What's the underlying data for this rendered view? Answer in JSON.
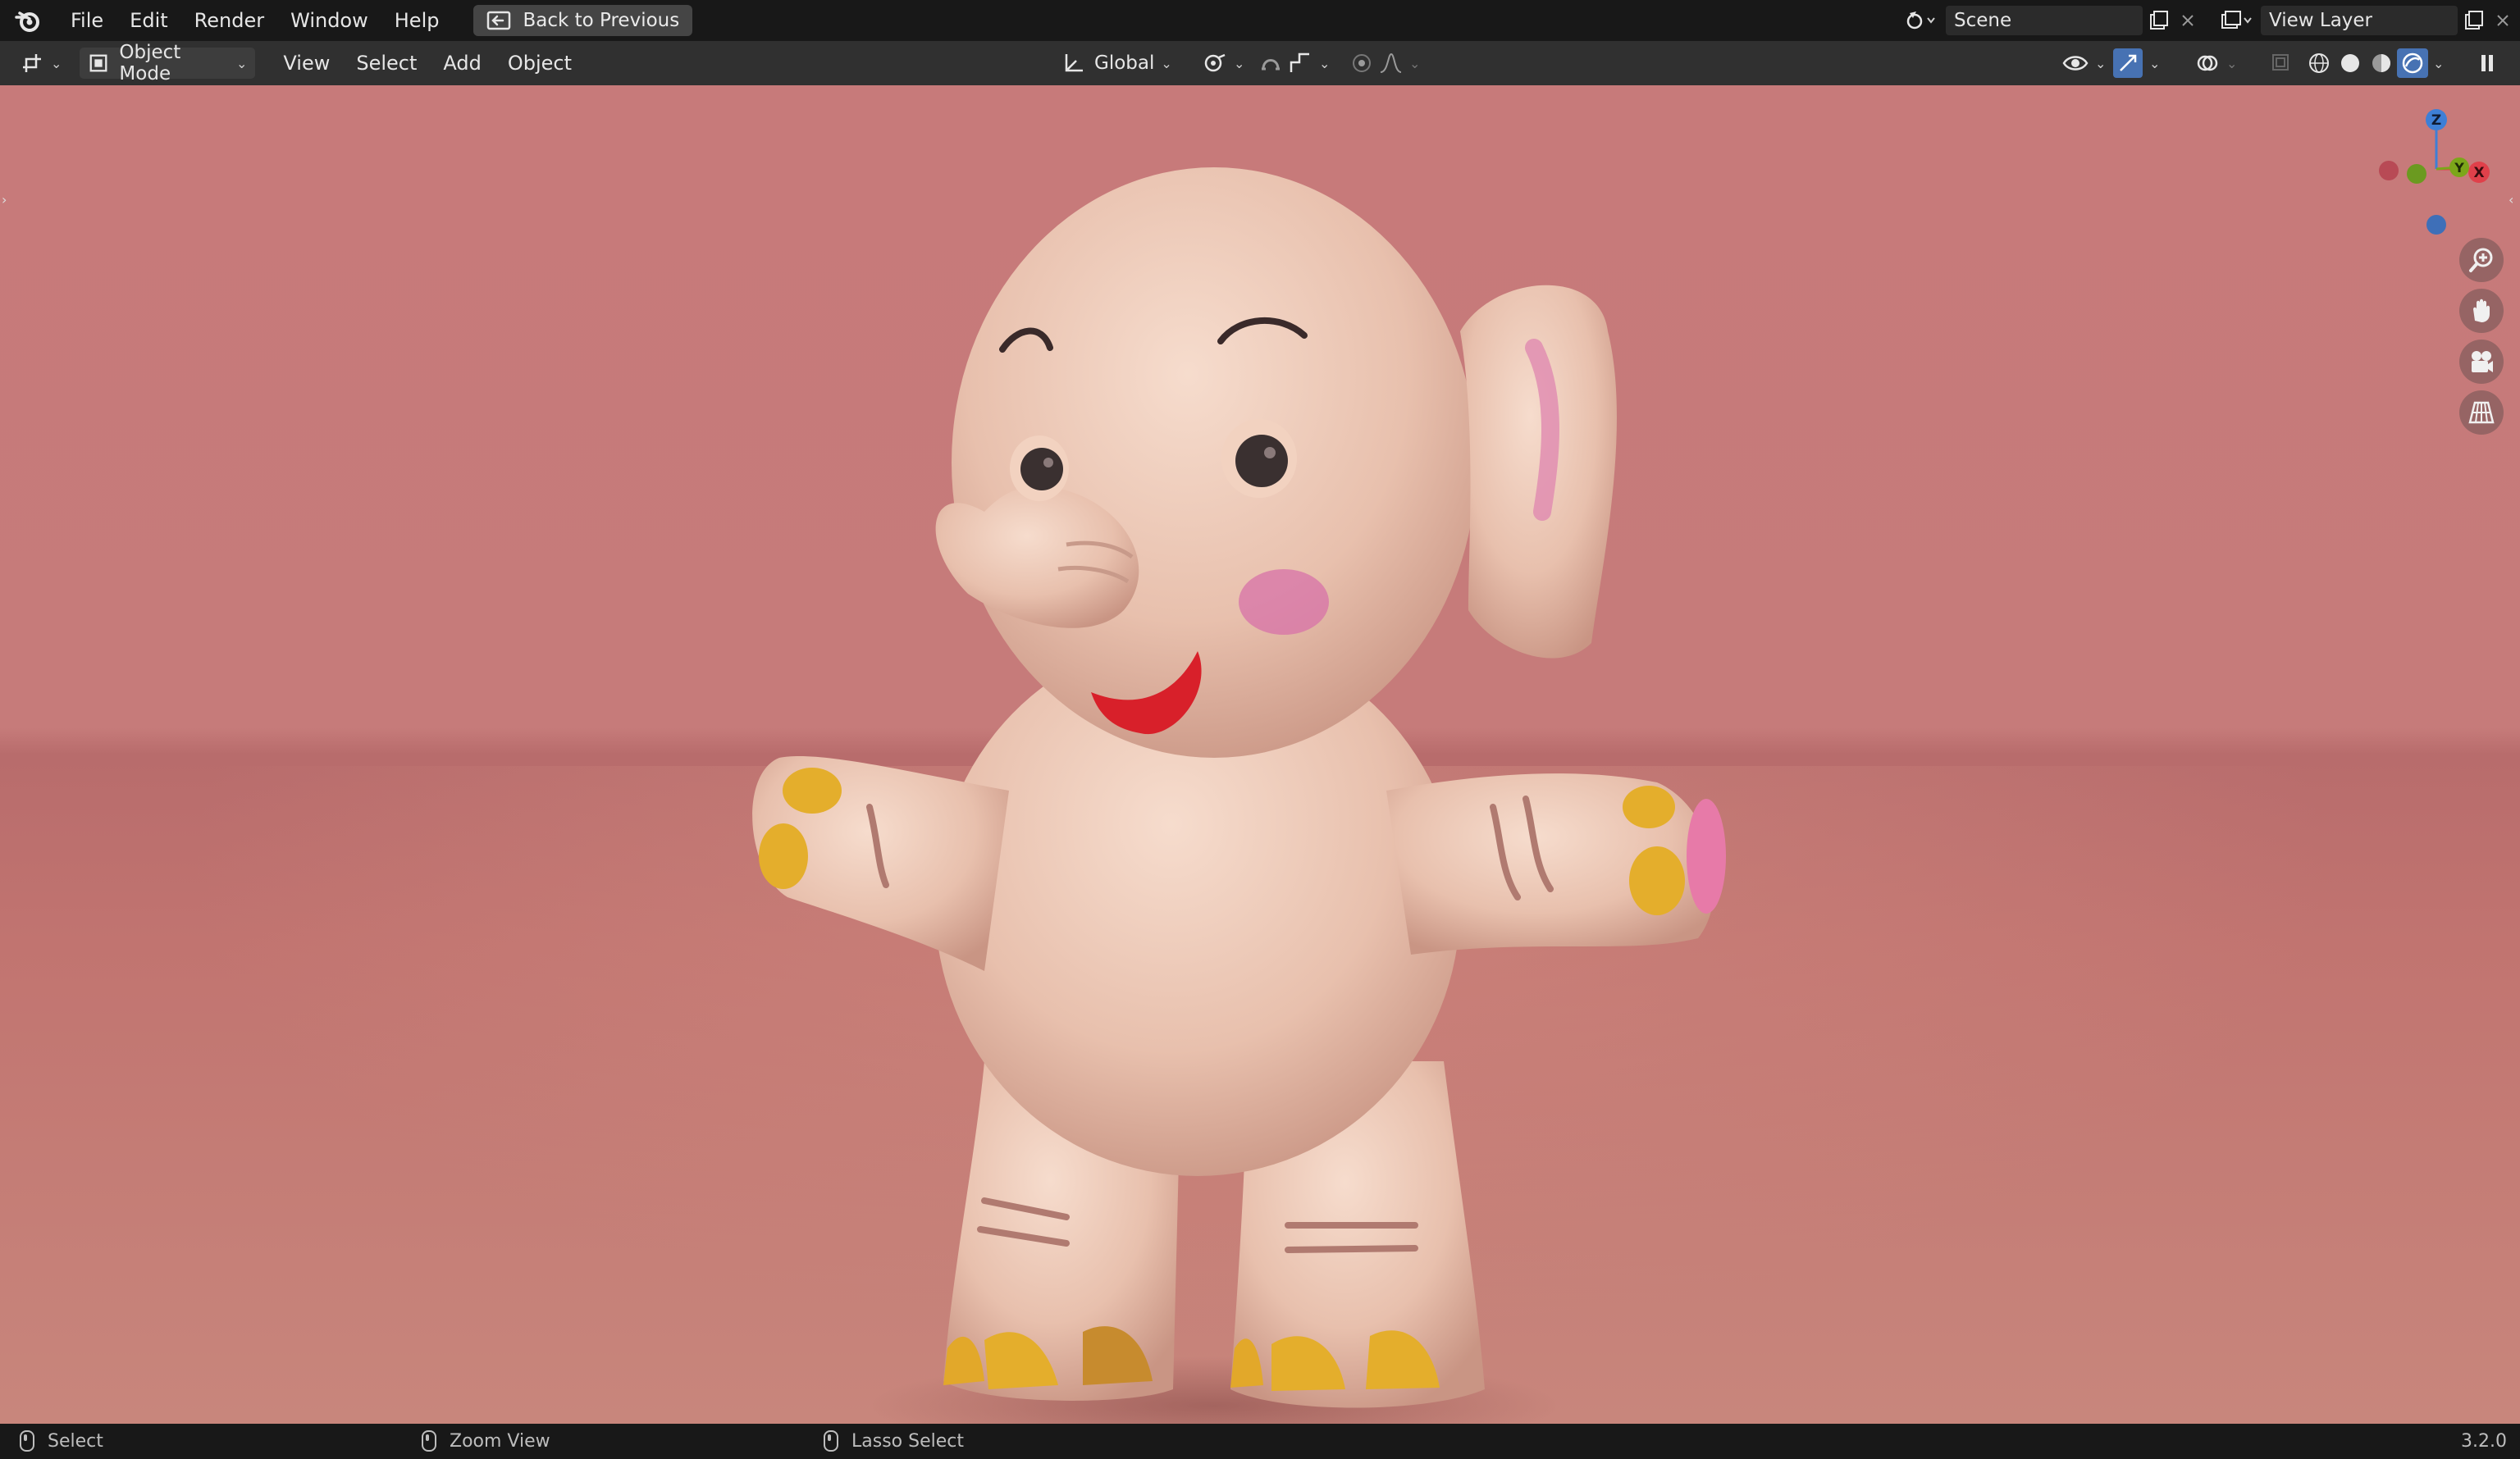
{
  "topbar": {
    "menu": [
      "File",
      "Edit",
      "Render",
      "Window",
      "Help"
    ],
    "back_label": "Back to Previous",
    "scene_name": "Scene",
    "view_layer_name": "View Layer"
  },
  "header": {
    "mode_label": "Object Mode",
    "menu": [
      "View",
      "Select",
      "Add",
      "Object"
    ],
    "transform_orientation": "Global"
  },
  "gizmo": {
    "z": "Z",
    "y": "Y",
    "x": "X"
  },
  "statusbar": {
    "left_click": "Select",
    "middle_click": "Zoom View",
    "right_click": "Lasso Select",
    "version": "3.2.0"
  },
  "colors": {
    "background_pink": "#c77a7a",
    "active_blue": "#4772b3",
    "axis_x": "#e0404a",
    "axis_y": "#7ca61a",
    "axis_z": "#3e7fd6"
  },
  "icons": [
    "blender-logo-icon",
    "back-arrow-icon",
    "scene-icon",
    "new-scene-icon",
    "close-icon",
    "view-layer-icon",
    "editor-type-icon",
    "object-mode-icon",
    "orientation-icon",
    "pivot-icon",
    "snap-icon",
    "proportional-icon",
    "visibility-icon",
    "gizmo-icon",
    "overlay-icon",
    "xray-icon",
    "wireframe-shading-icon",
    "solid-shading-icon",
    "material-shading-icon",
    "rendered-shading-icon",
    "pause-icon",
    "zoom-icon",
    "hand-icon",
    "camera-icon",
    "grid-icon",
    "mouse-icon"
  ]
}
